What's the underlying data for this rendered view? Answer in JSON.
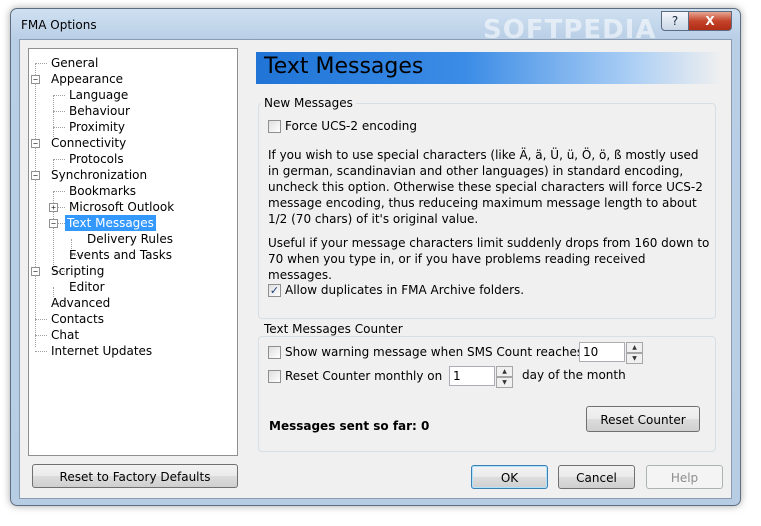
{
  "window": {
    "title": "FMA Options",
    "watermark": "SOFTPEDIA",
    "help_btn": "?",
    "close_btn": "X"
  },
  "tree": {
    "items": [
      {
        "label": "General"
      },
      {
        "label": "Appearance"
      },
      {
        "label": "Language"
      },
      {
        "label": "Behaviour"
      },
      {
        "label": "Proximity"
      },
      {
        "label": "Connectivity"
      },
      {
        "label": "Protocols"
      },
      {
        "label": "Synchronization"
      },
      {
        "label": "Bookmarks"
      },
      {
        "label": "Microsoft Outlook"
      },
      {
        "label": "Text Messages"
      },
      {
        "label": "Delivery Rules"
      },
      {
        "label": "Events and Tasks"
      },
      {
        "label": "Scripting"
      },
      {
        "label": "Editor"
      },
      {
        "label": "Advanced"
      },
      {
        "label": "Contacts"
      },
      {
        "label": "Chat"
      },
      {
        "label": "Internet Updates"
      }
    ],
    "selected": "Text Messages"
  },
  "header": {
    "title": "Text Messages"
  },
  "new_messages": {
    "label": "New Messages",
    "force_ucs2": "Force UCS-2 encoding",
    "force_ucs2_checked": false,
    "para1": "If you wish to use special characters (like Ä, ä, Ü, ü, Ö, ö, ß mostly used in german, scandinavian and other languages) in standard encoding, uncheck this option. Otherwise these special characters will force UCS-2 message encoding, thus reduceing maximum message length to about 1/2 (70 chars) of it's original value.",
    "para2": "Useful if your message characters limit suddenly drops from 160 down to 70 when you type in, or if you have problems reading received messages.",
    "allow_duplicates": "Allow duplicates in FMA Archive folders.",
    "allow_duplicates_checked": true
  },
  "counter": {
    "label": "Text Messages Counter",
    "show_warning": "Show warning message when SMS Count reaches",
    "show_warning_checked": false,
    "warning_value": "10",
    "reset_monthly": "Reset Counter monthly on",
    "reset_monthly_checked": false,
    "reset_day": "1",
    "day_suffix": "day of the month",
    "sent_so_far": "Messages sent so far: 0",
    "reset_button": "Reset Counter"
  },
  "buttons": {
    "factory": "Reset to Factory Defaults",
    "ok": "OK",
    "cancel": "Cancel",
    "help": "Help"
  },
  "glyphs": {
    "check": "✓",
    "plus": "+",
    "minus": "−",
    "up": "▲",
    "down": "▼"
  }
}
